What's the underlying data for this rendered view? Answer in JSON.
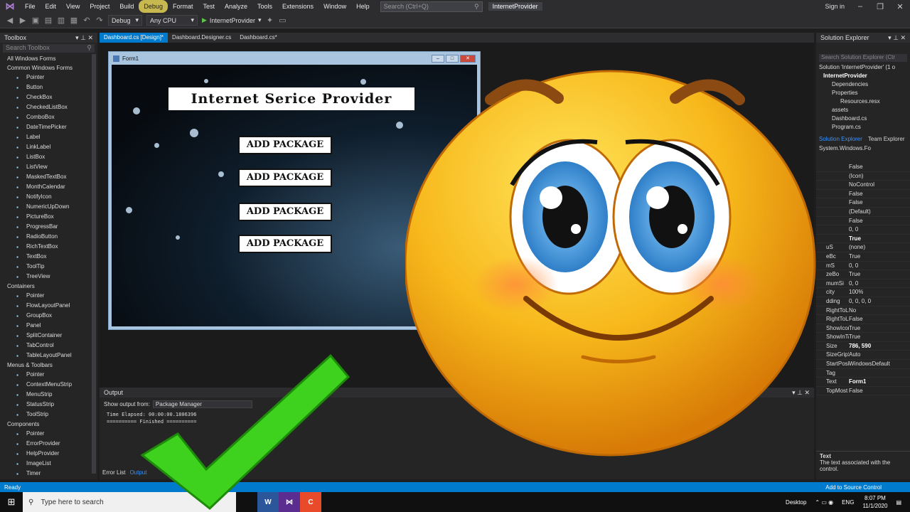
{
  "menubar": {
    "items": [
      "File",
      "Edit",
      "View",
      "Project",
      "Build",
      "Debug",
      "Format",
      "Test",
      "Analyze",
      "Tools",
      "Extensions",
      "Window",
      "Help"
    ],
    "search_placeholder": "Search (Ctrl+Q)",
    "solution_name": "InternetProvider",
    "signin": "Sign in"
  },
  "toolbar": {
    "config": "Debug",
    "platform": "Any CPU",
    "start_label": "InternetProvider"
  },
  "toolbox": {
    "title": "Toolbox",
    "search_placeholder": "Search Toolbox",
    "sections": [
      {
        "label": "All Windows Forms",
        "items": []
      },
      {
        "label": "Common Windows Forms",
        "items": [
          "Pointer",
          "Button",
          "CheckBox",
          "CheckedListBox",
          "ComboBox",
          "DateTimePicker",
          "Label",
          "LinkLabel",
          "ListBox",
          "ListView",
          "MaskedTextBox",
          "MonthCalendar",
          "NotifyIcon",
          "NumericUpDown",
          "PictureBox",
          "ProgressBar",
          "RadioButton",
          "RichTextBox",
          "TextBox",
          "ToolTip",
          "TreeView"
        ]
      },
      {
        "label": "Containers",
        "items": [
          "Pointer",
          "FlowLayoutPanel",
          "GroupBox",
          "Panel",
          "SplitContainer",
          "TabControl",
          "TableLayoutPanel"
        ]
      },
      {
        "label": "Menus & Toolbars",
        "items": [
          "Pointer",
          "ContextMenuStrip",
          "MenuStrip",
          "StatusStrip",
          "ToolStrip"
        ]
      },
      {
        "label": "Components",
        "items": [
          "Pointer",
          "ErrorProvider",
          "HelpProvider",
          "ImageList",
          "Timer"
        ]
      }
    ]
  },
  "doc_tabs": [
    "Dashboard.cs [Design]*",
    "Dashboard.Designer.cs",
    "Dashboard.cs*"
  ],
  "form": {
    "title": "Form1",
    "heading": "Internet Serice Provider",
    "buttons": [
      "ADD PACKAGE",
      "ADD PACKAGE",
      "ADD PACKAGE",
      "ADD PACKAGE"
    ]
  },
  "output": {
    "title": "Output",
    "show_from_label": "Show output from:",
    "source": "Package Manager",
    "lines": [
      "Time Elapsed: 00:00:00.1806396",
      "========== Finished =========="
    ]
  },
  "bottom_tabs": [
    "Error List",
    "Output"
  ],
  "solution_explorer": {
    "title": "Solution Explorer",
    "search_placeholder": "Search Solution Explorer (Ctr",
    "tree": [
      "Solution 'InternetProvider' (1 o",
      "InternetProvider",
      "Dependencies",
      "Properties",
      "Resources.resx",
      "assets",
      "Dashboard.cs",
      "Program.cs"
    ],
    "tabs": [
      "Solution Explorer",
      "Team Explorer"
    ]
  },
  "properties": {
    "object": "System.Windows.Fo",
    "rows": [
      {
        "name": "",
        "value": "False"
      },
      {
        "name": "",
        "value": "(Icon)"
      },
      {
        "name": "",
        "value": "NoControl"
      },
      {
        "name": "",
        "value": "False"
      },
      {
        "name": "",
        "value": "False"
      },
      {
        "name": "",
        "value": "(Default)"
      },
      {
        "name": "",
        "value": "False"
      },
      {
        "name": "",
        "value": "0, 0"
      },
      {
        "name": "",
        "value": "True"
      },
      {
        "name": "uS",
        "value": "(none)"
      },
      {
        "name": "eBc",
        "value": "True"
      },
      {
        "name": "mS",
        "value": "0, 0"
      },
      {
        "name": "zeBo",
        "value": "True"
      },
      {
        "name": "mumSi",
        "value": "0, 0"
      },
      {
        "name": "city",
        "value": "100%"
      },
      {
        "name": "dding",
        "value": "0, 0, 0, 0"
      },
      {
        "name": "RightToLeft",
        "value": "No"
      },
      {
        "name": "RightToLeftl",
        "value": "False"
      },
      {
        "name": "ShowIcon",
        "value": "True"
      },
      {
        "name": "ShowInTask",
        "value": "True"
      },
      {
        "name": "Size",
        "value": "786, 590"
      },
      {
        "name": "SizeGripStyl",
        "value": "Auto"
      },
      {
        "name": "StartPosition",
        "value": "WindowsDefault"
      },
      {
        "name": "Tag",
        "value": ""
      },
      {
        "name": "Text",
        "value": "Form1"
      },
      {
        "name": "TopMost",
        "value": "False"
      }
    ],
    "desc_title": "Text",
    "desc_body": "The text associated with the control."
  },
  "statusbar": {
    "ready": "Ready",
    "source_control": "Add to Source Control"
  },
  "taskbar": {
    "search_placeholder": "Type here to search",
    "desktop": "Desktop",
    "lang": "ENG",
    "time": "8:07 PM",
    "date": "11/1/2020"
  },
  "colors": {
    "accent": "#007acc",
    "checkmark": "#3ed21f",
    "emoji_face": "#f7b81b"
  },
  "icons": [
    "vs-logo-icon",
    "search-icon",
    "play-icon",
    "windows-start-icon",
    "smiley-emoji-icon",
    "checkmark-icon"
  ]
}
